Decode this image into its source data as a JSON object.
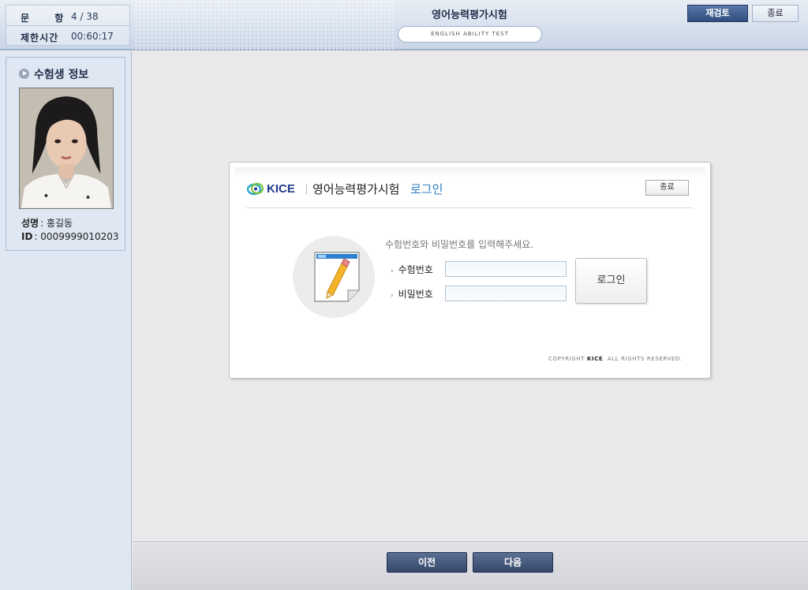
{
  "header": {
    "question_label": "문 항",
    "question_value": "4 / 38",
    "time_label": "제한시간",
    "time_value": "00:60:17",
    "title": "영어능력평가시험",
    "subtitle": "ENGLISH ABILITY TEST",
    "review_button": "재검토",
    "exit_button": "종료"
  },
  "candidate": {
    "heading": "수험생 정보",
    "name_label": "성명",
    "name_value": ": 홍길동",
    "id_label": "ID",
    "id_value": ": 0009999010203"
  },
  "login": {
    "logo_text": "KICE",
    "title": "영어능력평가시험",
    "title_accent": "로그인",
    "close_button": "종료",
    "instruction": "수험번호와 비밀번호를 입력해주세요.",
    "field1_label": "수험번호",
    "field1_value": "",
    "field2_label": "비밀번호",
    "field2_value": "",
    "login_button": "로그인",
    "copyright_prefix": "COPYRIGHT",
    "copyright_brand": "KICE",
    "copyright_suffix": ". ALL RIGHTS RESERVED."
  },
  "footer": {
    "prev_button": "이전",
    "next_button": "다음"
  },
  "colors": {
    "accent_blue": "#2b7cc4",
    "nav_button": "#34476b",
    "review_button": "#324e80"
  },
  "icons": {
    "candidate_heading_icon": "play-circle-icon",
    "document_icon": "test-document-pencil-icon",
    "logo_icon": "kice-ring-icon"
  }
}
